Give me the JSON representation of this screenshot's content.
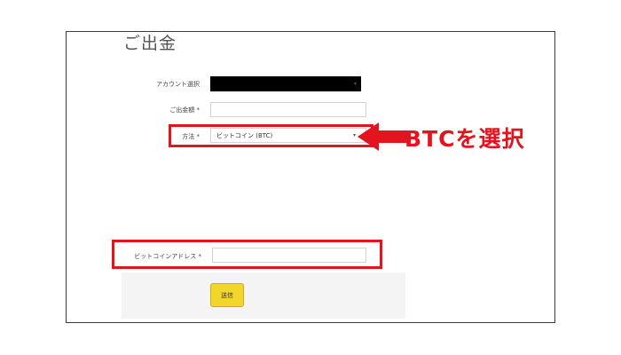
{
  "page": {
    "title": "ご出金"
  },
  "form": {
    "account": {
      "label": "アカウント選択",
      "value": ""
    },
    "amount": {
      "label": "ご出金額 *",
      "value": ""
    },
    "method": {
      "label": "方法 *",
      "value": "ビットコイン (BTC)"
    },
    "btc_address": {
      "label": "ビットコインアドレス *",
      "value": ""
    },
    "submit_label": "送信"
  },
  "annotation": {
    "text": "BTCを選択",
    "color": "#e4141e"
  },
  "colors": {
    "highlight": "#e4141e",
    "button": "#f3d62b",
    "submit_area": "#f4f4f4"
  },
  "icons": {
    "select_arrow": "▾",
    "pointer": "arrow-left-icon"
  }
}
